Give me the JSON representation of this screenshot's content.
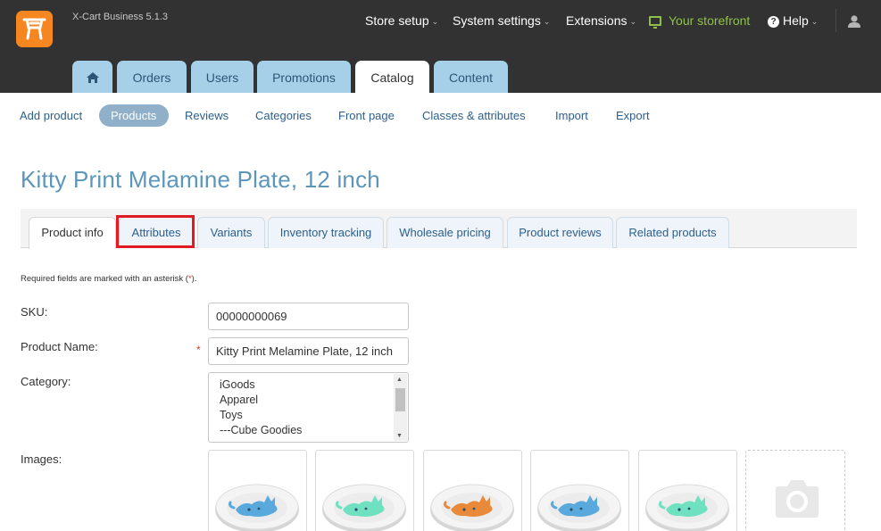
{
  "header": {
    "app_version": "X-Cart Business 5.1.3",
    "nav": [
      {
        "label": "Store setup"
      },
      {
        "label": "System settings"
      },
      {
        "label": "Extensions"
      },
      {
        "label": "Your storefront"
      },
      {
        "label": "Help"
      }
    ],
    "icons": {
      "logo": "xcart-cart-logo",
      "storefront": "monitor-icon",
      "help": "question-circle-icon",
      "user": "user-icon",
      "home": "home-icon"
    }
  },
  "main_tabs": [
    {
      "label": "Orders"
    },
    {
      "label": "Users"
    },
    {
      "label": "Promotions"
    },
    {
      "label": "Catalog"
    },
    {
      "label": "Content"
    }
  ],
  "main_tabs_active": "Catalog",
  "sub_nav": [
    {
      "label": "Add product"
    },
    {
      "label": "Products"
    },
    {
      "label": "Reviews"
    },
    {
      "label": "Categories"
    },
    {
      "label": "Front page"
    },
    {
      "label": "Classes & attributes"
    },
    {
      "label": "Import"
    },
    {
      "label": "Export"
    }
  ],
  "sub_nav_active": "Products",
  "page_title": "Kitty Print Melamine Plate, 12 inch",
  "product_tabs": [
    {
      "label": "Product info"
    },
    {
      "label": "Attributes"
    },
    {
      "label": "Variants"
    },
    {
      "label": "Inventory tracking"
    },
    {
      "label": "Wholesale pricing"
    },
    {
      "label": "Product reviews"
    },
    {
      "label": "Related products"
    }
  ],
  "product_tabs_active": "Product info",
  "highlighted_tab": "Attributes",
  "form": {
    "required_note_prefix": "Required fields are marked with an asterisk (",
    "required_note_star": "*",
    "required_note_suffix": ").",
    "sku_label": "SKU:",
    "sku_value": "00000000069",
    "name_label": "Product Name:",
    "name_required": "*",
    "name_value": "Kitty Print Melamine Plate, 12 inch",
    "category_label": "Category:",
    "category_options": [
      "iGoods",
      "Apparel",
      "Toys",
      "---Cube Goodies"
    ],
    "images_label": "Images:"
  },
  "images": [
    {
      "cat_color": "#5aa9dc"
    },
    {
      "cat_color": "#6fe0c0"
    },
    {
      "cat_color": "#e98a3a"
    },
    {
      "cat_color": "#5aa9dc"
    },
    {
      "cat_color": "#6fe0c0"
    }
  ],
  "colors": {
    "header_bg": "#323232",
    "logo_orange": "#f6861f",
    "tab_blue": "#a6d0e8",
    "link_blue": "#2b5f8e",
    "title_blue": "#5c96bb",
    "storefront_green": "#8fc14a",
    "highlight_red": "#e01b24"
  }
}
